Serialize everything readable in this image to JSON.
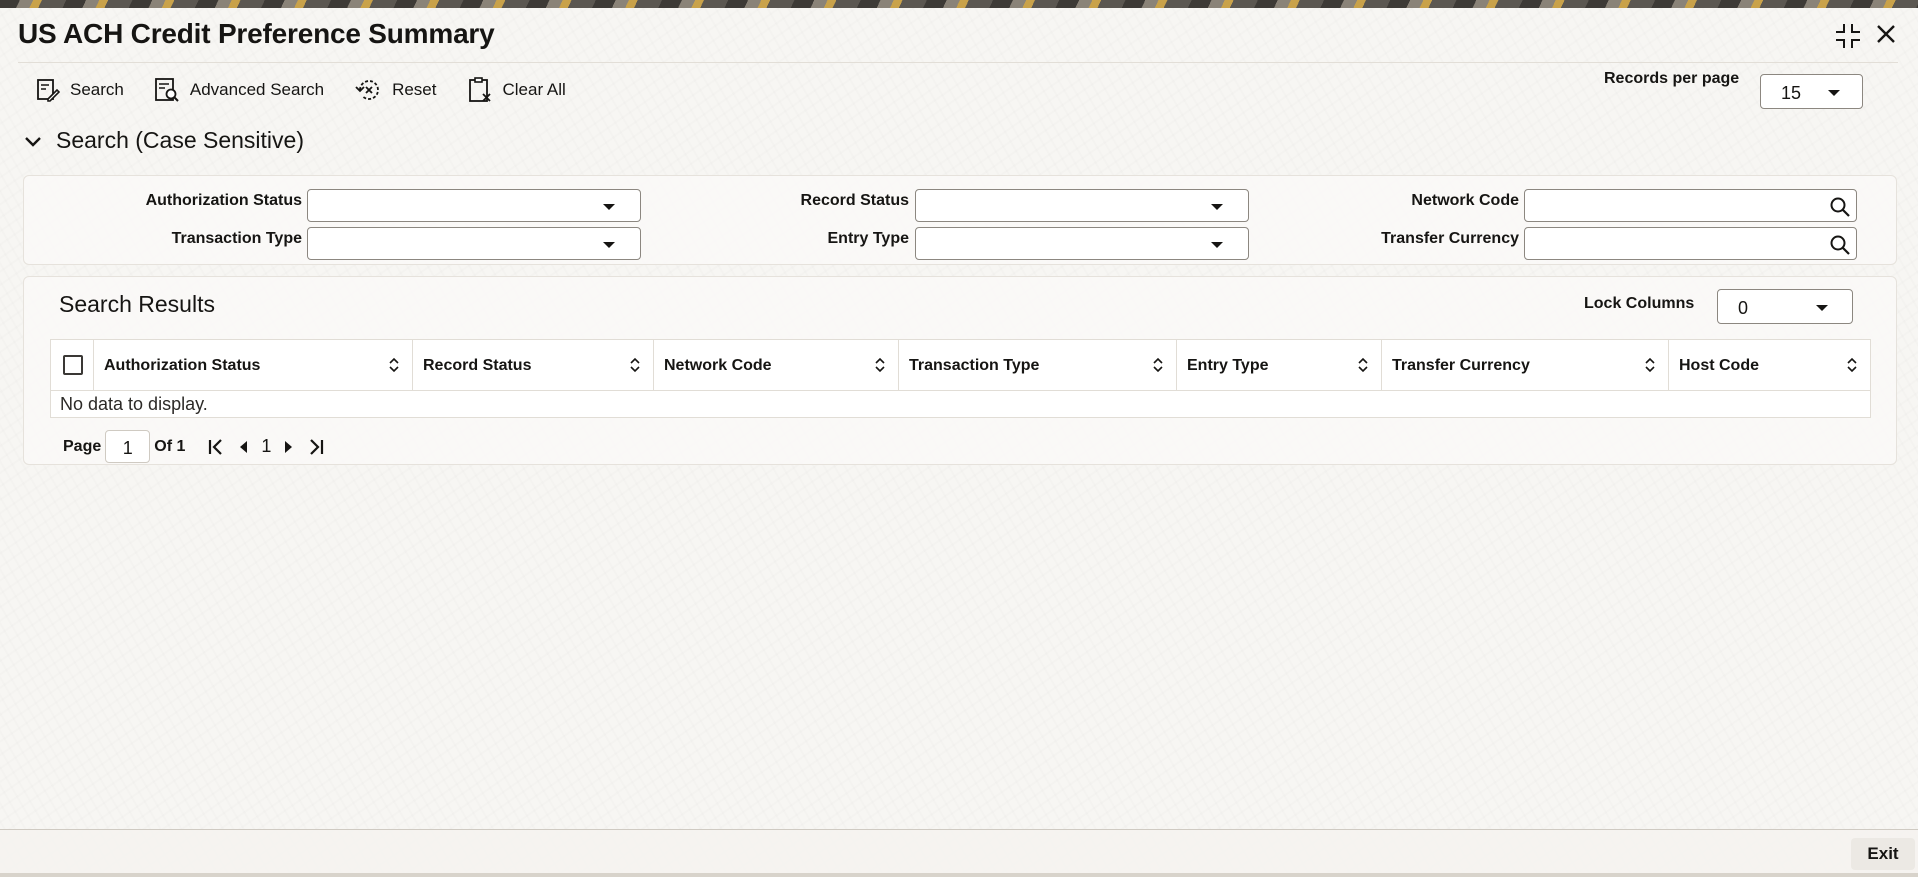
{
  "window": {
    "title": "US ACH Credit Preference Summary"
  },
  "toolbar": {
    "search_label": "Search",
    "advanced_search_label": "Advanced Search",
    "reset_label": "Reset",
    "clear_all_label": "Clear All",
    "records_per_page_label": "Records per page",
    "records_per_page_value": "15"
  },
  "search_section": {
    "heading": "Search (Case Sensitive)",
    "fields": {
      "authorization_status": {
        "label": "Authorization Status",
        "value": ""
      },
      "record_status": {
        "label": "Record Status",
        "value": ""
      },
      "network_code": {
        "label": "Network Code",
        "value": ""
      },
      "transaction_type": {
        "label": "Transaction Type",
        "value": ""
      },
      "entry_type": {
        "label": "Entry Type",
        "value": ""
      },
      "transfer_currency": {
        "label": "Transfer Currency",
        "value": ""
      }
    }
  },
  "results": {
    "title": "Search Results",
    "lock_columns_label": "Lock Columns",
    "lock_columns_value": "0",
    "columns": [
      "Authorization Status",
      "Record Status",
      "Network Code",
      "Transaction Type",
      "Entry Type",
      "Transfer Currency",
      "Host Code"
    ],
    "empty_message": "No data to display."
  },
  "pagination": {
    "page_label": "Page",
    "page_value": "1",
    "of_label": "Of 1",
    "current_page": "1"
  },
  "footer": {
    "exit_label": "Exit"
  },
  "icons": {
    "maximize": "compress-icon",
    "close": "close-icon",
    "search": "search-icon",
    "advanced_search": "advanced-search-icon",
    "reset": "reset-icon",
    "clear_all": "clipboard-clear-icon",
    "collapse": "chevron-down-icon",
    "sort": "sort-icon"
  }
}
